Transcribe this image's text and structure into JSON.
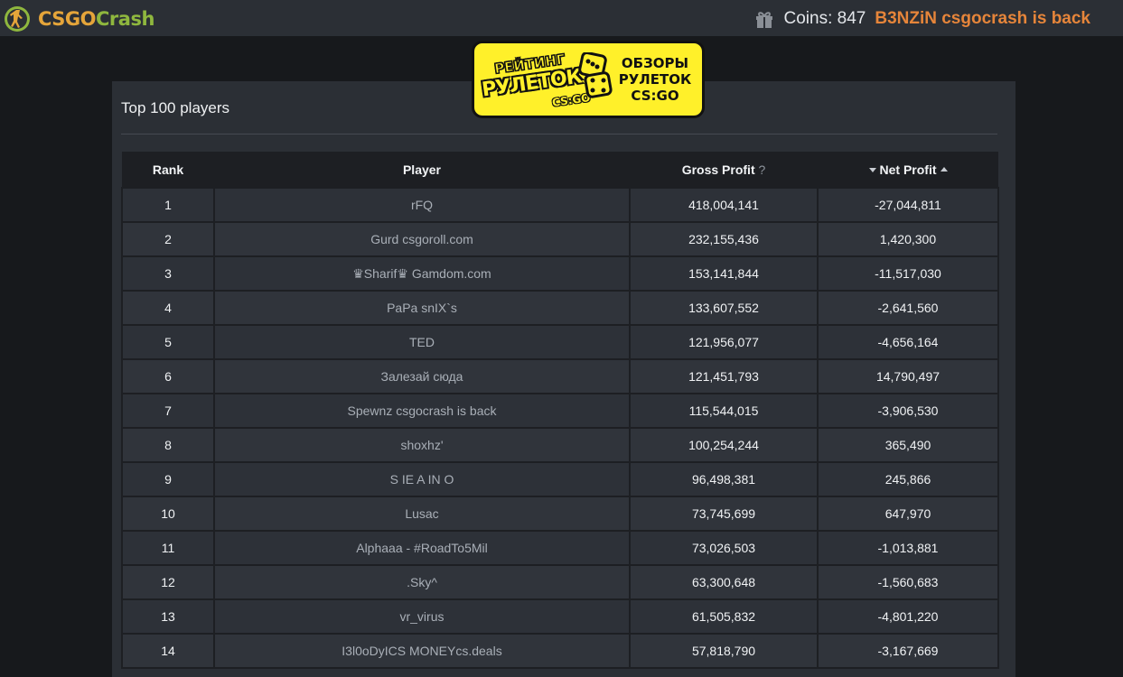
{
  "header": {
    "logo_part1": "CSGO",
    "logo_part2": "Crash",
    "coins_label": "Coins: 847",
    "username": "B3NZiN csgocrash is back"
  },
  "banner": {
    "left_line1": "РЕЙТИНГ",
    "left_line2": "РУЛЕТОК",
    "left_line3": "CS:GO",
    "right_line1": "ОБЗОРЫ",
    "right_line2": "РУЛЕТОК",
    "right_line3": "CS:GO"
  },
  "leaderboard": {
    "title": "Top 100 players",
    "columns": {
      "rank": "Rank",
      "player": "Player",
      "gross": "Gross Profit",
      "gross_help": "?",
      "net": "Net Profit"
    },
    "rows": [
      {
        "rank": "1",
        "player": "rFQ",
        "gross": "418,004,141",
        "net": "-27,044,811"
      },
      {
        "rank": "2",
        "player": "Gurd csgoroll.com",
        "gross": "232,155,436",
        "net": "1,420,300"
      },
      {
        "rank": "3",
        "player": "♛Sharif♛ Gamdom.com",
        "gross": "153,141,844",
        "net": "-11,517,030"
      },
      {
        "rank": "4",
        "player": "PaPa snIX`s",
        "gross": "133,607,552",
        "net": "-2,641,560"
      },
      {
        "rank": "5",
        "player": "TED",
        "gross": "121,956,077",
        "net": "-4,656,164"
      },
      {
        "rank": "6",
        "player": "Залезай сюда",
        "gross": "121,451,793",
        "net": "14,790,497"
      },
      {
        "rank": "7",
        "player": "Spewnz csgocrash is back",
        "gross": "115,544,015",
        "net": "-3,906,530"
      },
      {
        "rank": "8",
        "player": "shoxhz'",
        "gross": "100,254,244",
        "net": "365,490"
      },
      {
        "rank": "9",
        "player": "S IE A IN O",
        "gross": "96,498,381",
        "net": "245,866"
      },
      {
        "rank": "10",
        "player": "Lusac",
        "gross": "73,745,699",
        "net": "647,970"
      },
      {
        "rank": "11",
        "player": "Alphaaa - #RoadTo5Mil",
        "gross": "73,026,503",
        "net": "-1,013,881"
      },
      {
        "rank": "12",
        "player": ".Sky^",
        "gross": "63,300,648",
        "net": "-1,560,683"
      },
      {
        "rank": "13",
        "player": "vr_virus",
        "gross": "61,505,832",
        "net": "-4,801,220"
      },
      {
        "rank": "14",
        "player": "I3l0oDyICS MONEYcs.deals",
        "gross": "57,818,790",
        "net": "-3,167,669"
      }
    ]
  }
}
